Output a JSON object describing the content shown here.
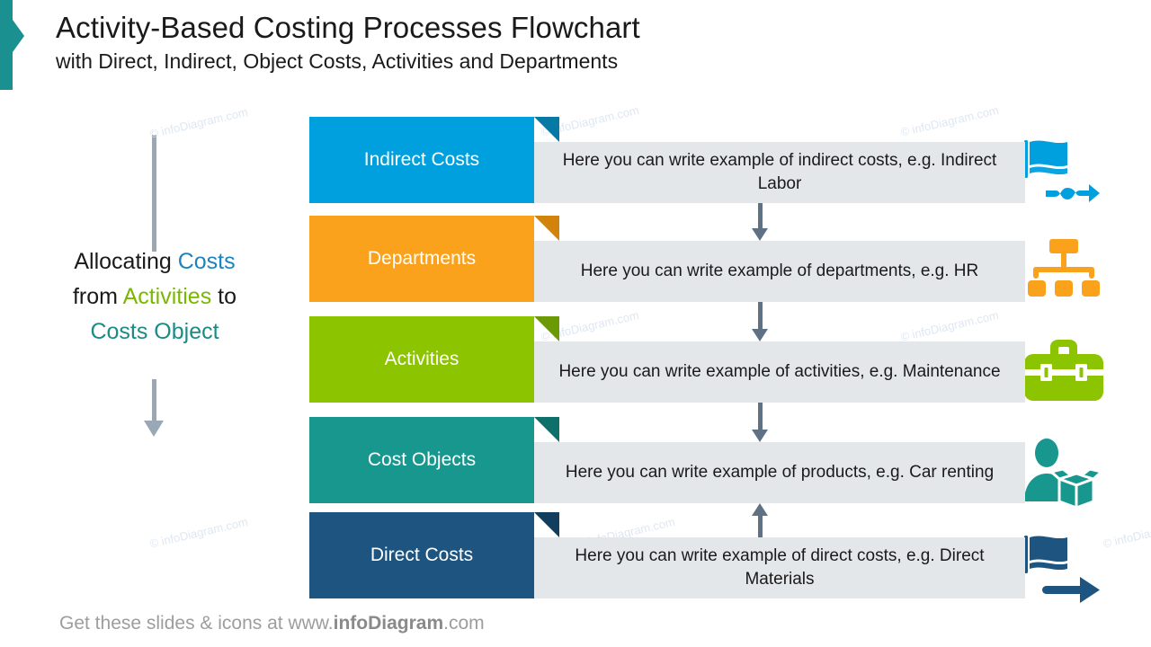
{
  "title": {
    "main": "Activity-Based Costing Processes Flowchart",
    "subtitle": "with Direct, Indirect, Object Costs, Activities and Departments",
    "accent_color": "#1a9090"
  },
  "left_caption": {
    "line1_prefix": "Allocating ",
    "line1_highlight": "Costs",
    "line2_prefix": "from ",
    "line2_highlight": "Activities",
    "line2_suffix": " to",
    "line3_highlight": "Costs Object",
    "costs_color": "#1b84bd",
    "activities_color": "#7ab800",
    "costs_object_color": "#1a8c85",
    "arrow_color": "#9aa7b4"
  },
  "rows": [
    {
      "label": "Indirect Costs",
      "description": "Here you can write example of indirect costs, e.g. Indirect Labor",
      "color": "#00A0DF",
      "fold_color": "#0679a5",
      "icon": "flag-wavy-arrow-icon"
    },
    {
      "label": "Departments",
      "description": "Here you can write example of departments, e.g. HR",
      "color": "#FBA21D",
      "fold_color": "#d1830c",
      "icon": "org-chart-icon"
    },
    {
      "label": "Activities",
      "description": "Here you can write example of activities, e.g. Maintenance",
      "color": "#8DC400",
      "fold_color": "#6c9a05",
      "icon": "briefcase-icon"
    },
    {
      "label": "Cost Objects",
      "description": "Here you can write example of products, e.g. Car renting",
      "color": "#18978F",
      "fold_color": "#0f6f6a",
      "icon": "person-box-icon"
    },
    {
      "label": "Direct Costs",
      "description": "Here you can write example of direct costs, e.g. Direct Materials",
      "color": "#1D5580",
      "fold_color": "#113d5e",
      "icon": "flag-straight-arrow-icon"
    }
  ],
  "connectors": [
    {
      "direction": "down"
    },
    {
      "direction": "down"
    },
    {
      "direction": "down"
    },
    {
      "direction": "up"
    }
  ],
  "watermark": "© infoDiagram.com",
  "footer": {
    "prefix": "Get these slides & icons at www.",
    "brand": "infoDiagram",
    "suffix": ".com"
  }
}
